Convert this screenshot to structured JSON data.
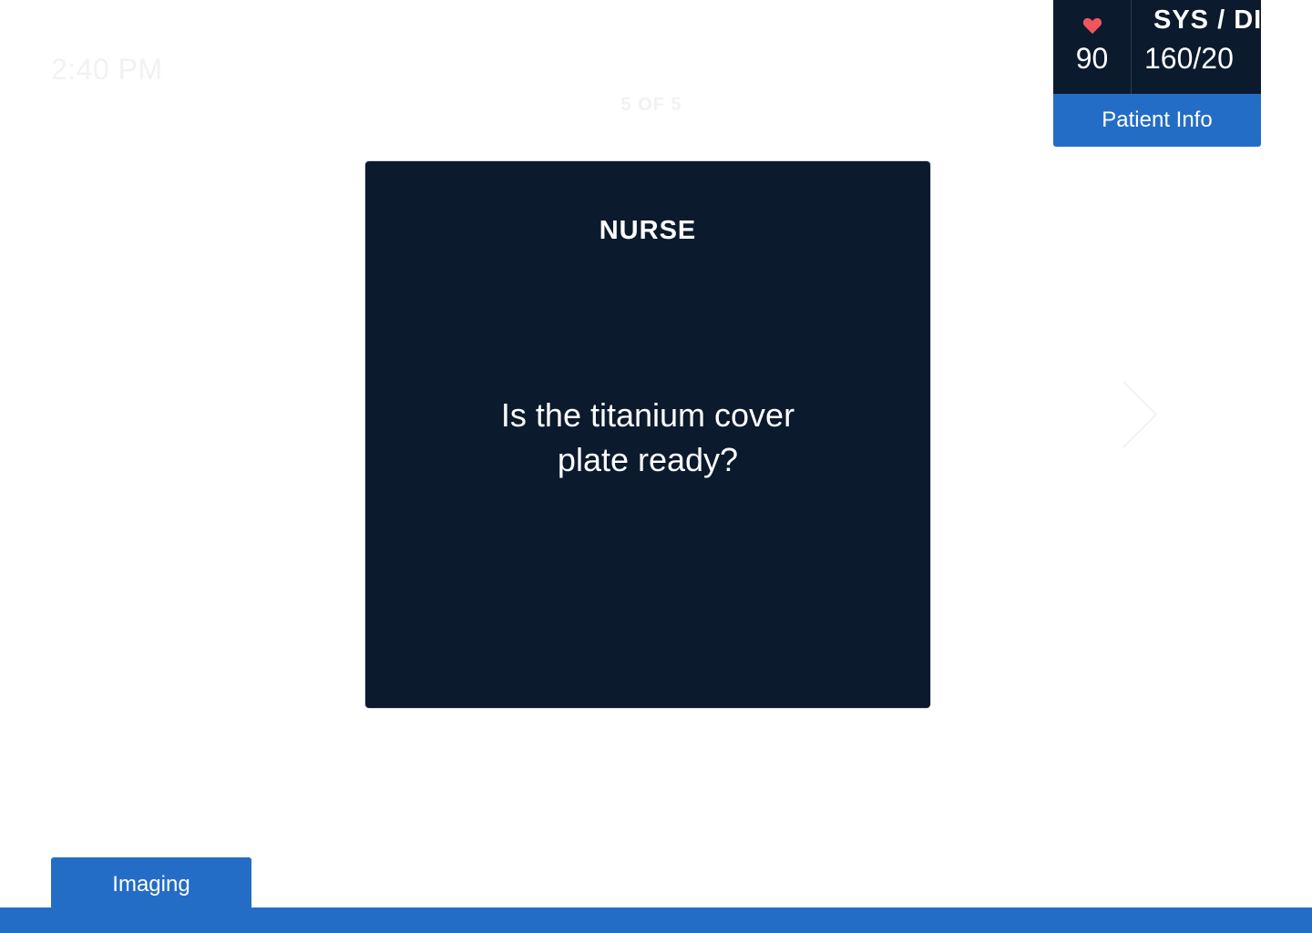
{
  "clock": {
    "time": "2:40 PM"
  },
  "carousel": {
    "counter": "5 OF 5"
  },
  "card": {
    "role": "NURSE",
    "question": "Is the titanium cover plate ready?"
  },
  "vitals": {
    "heart_rate_icon": "heart-icon",
    "heart_rate": "90",
    "bp_label": "SYS / DIA",
    "bp_value": "160/20",
    "patient_info_label": "Patient Info"
  },
  "tabs": {
    "imaging_label": "Imaging"
  },
  "colors": {
    "background": "#ffffff",
    "card": "#0b1a2c",
    "accent": "#246dc6",
    "heart": "#f0555e"
  }
}
